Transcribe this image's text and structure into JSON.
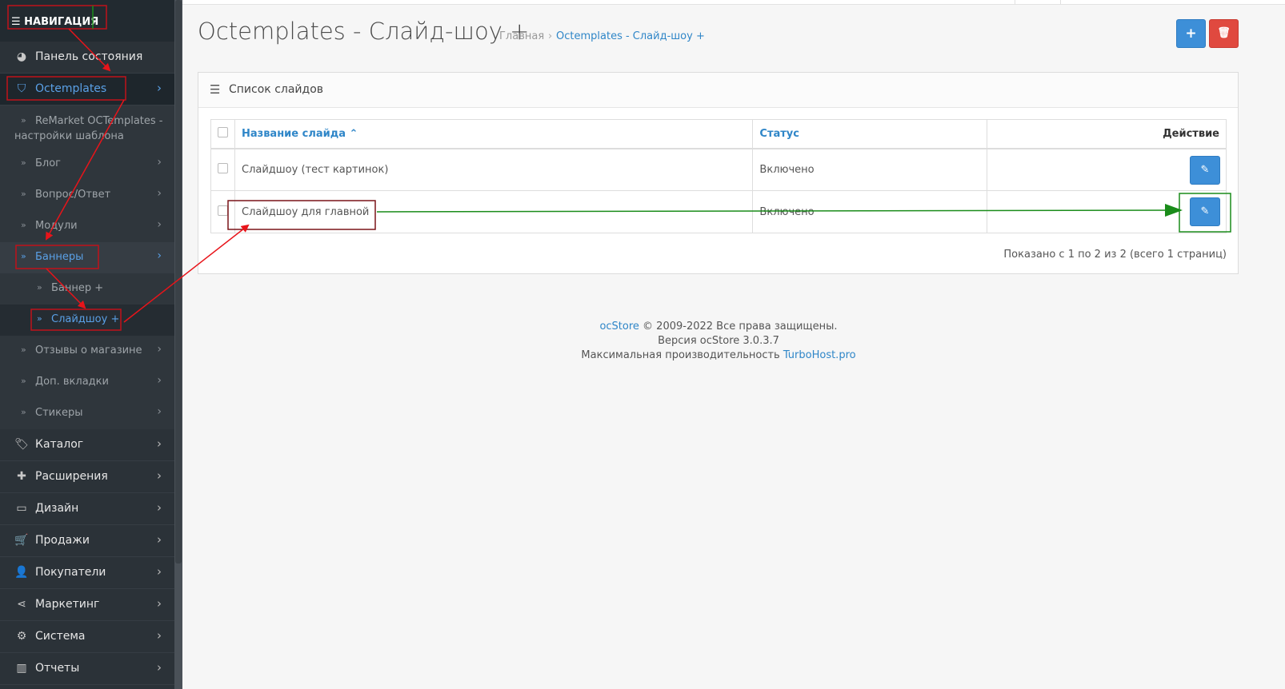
{
  "sidebar": {
    "header": "☰ НАВИГАЦИЯ",
    "top": [
      {
        "label": "Панель состояния",
        "icon": "dashboard-icon",
        "glyph": "◕"
      },
      {
        "label": "Octemplates",
        "icon": "shield-icon",
        "glyph": "⛉"
      }
    ],
    "octemplates_sub": [
      {
        "label": "ReMarket OCTemplates - настройки шаблона"
      },
      {
        "label": "Блог"
      },
      {
        "label": "Вопрос/Ответ"
      },
      {
        "label": "Модули"
      },
      {
        "label": "Баннеры"
      },
      {
        "label": "Баннер +"
      },
      {
        "label": "Слайдшоу +"
      },
      {
        "label": "Отзывы о магазине"
      },
      {
        "label": "Доп. вкладки"
      },
      {
        "label": "Стикеры"
      }
    ],
    "bottom": [
      {
        "label": "Каталог",
        "icon": "tags-icon",
        "glyph": "🏷"
      },
      {
        "label": "Расширения",
        "icon": "puzzle-icon",
        "glyph": "✚"
      },
      {
        "label": "Дизайн",
        "icon": "monitor-icon",
        "glyph": "▭"
      },
      {
        "label": "Продажи",
        "icon": "cart-icon",
        "glyph": "🛒"
      },
      {
        "label": "Покупатели",
        "icon": "user-icon",
        "glyph": "👤"
      },
      {
        "label": "Маркетинг",
        "icon": "share-icon",
        "glyph": "⋖"
      },
      {
        "label": "Система",
        "icon": "gear-icon",
        "glyph": "⚙"
      },
      {
        "label": "Отчеты",
        "icon": "bar-chart-icon",
        "glyph": "▥"
      }
    ]
  },
  "header": {
    "title": "Octemplates - Слайд-шоу +",
    "breadcrumb_home": "Главная",
    "breadcrumb_sep": "›",
    "breadcrumb_current": "Octemplates - Слайд-шоу +",
    "add_button": "+",
    "delete_button": "🗑"
  },
  "panel": {
    "title": "Список слайдов",
    "columns": {
      "name": "Название слайда ⌃",
      "status": "Статус",
      "action": "Действие"
    },
    "rows": [
      {
        "name": "Слайдшоу (тест картинок)",
        "status": "Включено"
      },
      {
        "name": "Слайдшоу для главной",
        "status": "Включено"
      }
    ],
    "edit_glyph": "✎",
    "pagination": "Показано с 1 по 2 из 2 (всего 1 страниц)"
  },
  "footer": {
    "brand_link": "ocStore",
    "copyright": " © 2009-2022 Все права защищены.",
    "version": "Версия ocStore 3.0.3.7",
    "perf_text": "Максимальная производительность ",
    "host_link": "TurboHost.pro"
  },
  "colors": {
    "sidebar_bg": "#2b3238",
    "accent_blue": "#3d8fd8",
    "danger_red": "#e0493f",
    "annotation_red": "#e8141a",
    "annotation_green": "#1a8c1a"
  }
}
